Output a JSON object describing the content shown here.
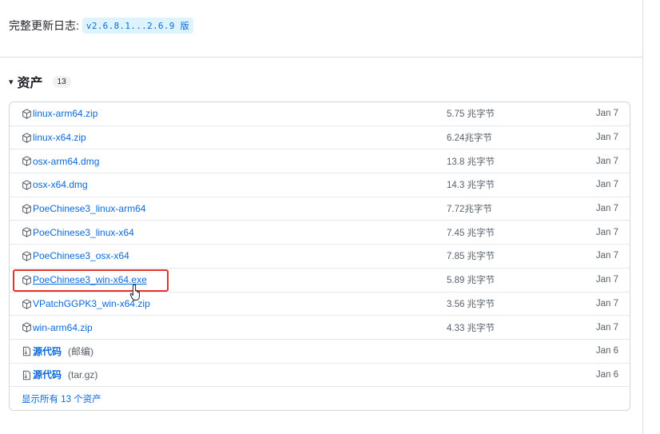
{
  "changelog": {
    "label": "完整更新日志:",
    "version_range": "v2.6.8.1...2.6.9 版"
  },
  "assets": {
    "caret": "▾",
    "title": "资产",
    "count": "13",
    "rows": [
      {
        "name": "linux-arm64.zip",
        "size": "5.75 兆字节",
        "date": "Jan 7",
        "icon": "package-icon"
      },
      {
        "name": "linux-x64.zip",
        "size": "6.24兆字节",
        "date": "Jan 7",
        "icon": "package-icon"
      },
      {
        "name": "osx-arm64.dmg",
        "size": "13.8 兆字节",
        "date": "Jan 7",
        "icon": "package-icon"
      },
      {
        "name": "osx-x64.dmg",
        "size": "14.3 兆字节",
        "date": "Jan 7",
        "icon": "package-icon"
      },
      {
        "name": "PoeChinese3_linux-arm64",
        "size": "7.72兆字节",
        "date": "Jan 7",
        "icon": "package-icon"
      },
      {
        "name": "PoeChinese3_linux-x64",
        "size": "7.45 兆字节",
        "date": "Jan 7",
        "icon": "package-icon"
      },
      {
        "name": "PoeChinese3_osx-x64",
        "size": "7.85 兆字节",
        "date": "Jan 7",
        "icon": "package-icon"
      },
      {
        "name": "PoeChinese3_win-x64.exe",
        "size": "5.89 兆字节",
        "date": "Jan 7",
        "icon": "package-icon"
      },
      {
        "name": "VPatchGGPK3_win-x64.zip",
        "size": "3.56 兆字节",
        "date": "Jan 7",
        "icon": "package-icon"
      },
      {
        "name": "win-arm64.zip",
        "size": "4.33 兆字节",
        "date": "Jan 7",
        "icon": "package-icon"
      }
    ],
    "source_rows": [
      {
        "name": "源代码",
        "suffix": "(邮编)",
        "date": "Jan 6",
        "icon": "file-zip-icon"
      },
      {
        "name": "源代码",
        "suffix": "(tar.gz)",
        "date": "Jan 6",
        "icon": "file-zip-icon"
      }
    ],
    "show_all": "显示所有 13 个资产"
  },
  "colors": {
    "link": "#0969da",
    "highlight_border": "#e5322d"
  }
}
